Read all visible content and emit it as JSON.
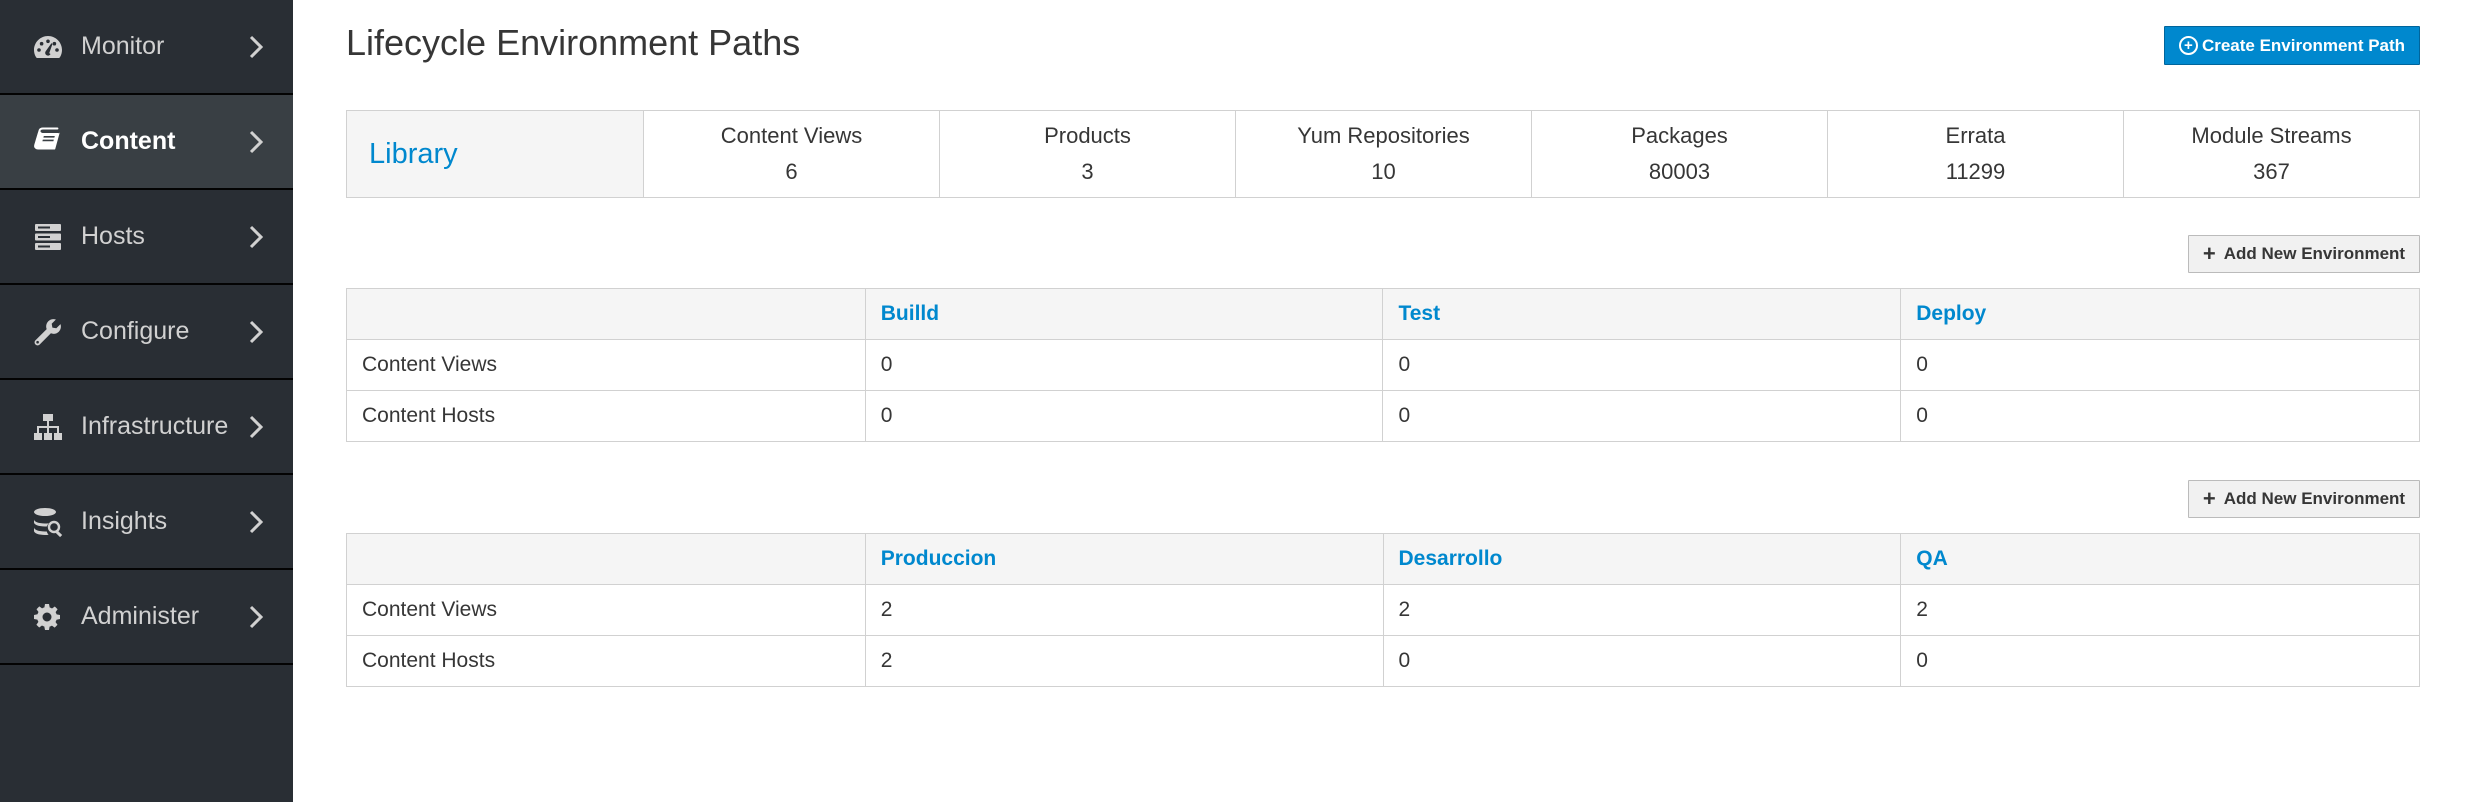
{
  "sidebar": {
    "items": [
      {
        "label": "Monitor",
        "icon": "dashboard-icon",
        "active": false
      },
      {
        "label": "Content",
        "icon": "book-icon",
        "active": true
      },
      {
        "label": "Hosts",
        "icon": "server-icon",
        "active": false
      },
      {
        "label": "Configure",
        "icon": "wrench-icon",
        "active": false
      },
      {
        "label": "Infrastructure",
        "icon": "network-icon",
        "active": false
      },
      {
        "label": "Insights",
        "icon": "database-search-icon",
        "active": false
      },
      {
        "label": "Administer",
        "icon": "gear-icon",
        "active": false
      }
    ]
  },
  "page": {
    "title": "Lifecycle Environment Paths",
    "create_button": "Create Environment Path"
  },
  "library": {
    "name": "Library",
    "stats": [
      {
        "label": "Content Views",
        "value": "6"
      },
      {
        "label": "Products",
        "value": "3"
      },
      {
        "label": "Yum Repositories",
        "value": "10"
      },
      {
        "label": "Packages",
        "value": "80003"
      },
      {
        "label": "Errata",
        "value": "11299"
      },
      {
        "label": "Module Streams",
        "value": "367"
      }
    ]
  },
  "paths": [
    {
      "add_button": "Add New Environment",
      "environments": [
        "Builld",
        "Test",
        "Deploy"
      ],
      "rows": [
        {
          "label": "Content Views",
          "values": [
            "0",
            "0",
            "0"
          ]
        },
        {
          "label": "Content Hosts",
          "values": [
            "0",
            "0",
            "0"
          ]
        }
      ]
    },
    {
      "add_button": "Add New Environment",
      "environments": [
        "Produccion",
        "Desarrollo",
        "QA"
      ],
      "rows": [
        {
          "label": "Content Views",
          "values": [
            "2",
            "2",
            "2"
          ]
        },
        {
          "label": "Content Hosts",
          "values": [
            "2",
            "0",
            "0"
          ]
        }
      ]
    }
  ],
  "colors": {
    "sidebar_bg": "#292e34",
    "sidebar_active": "#393f44",
    "link": "#0088ce",
    "primary_button": "#0088ce"
  }
}
